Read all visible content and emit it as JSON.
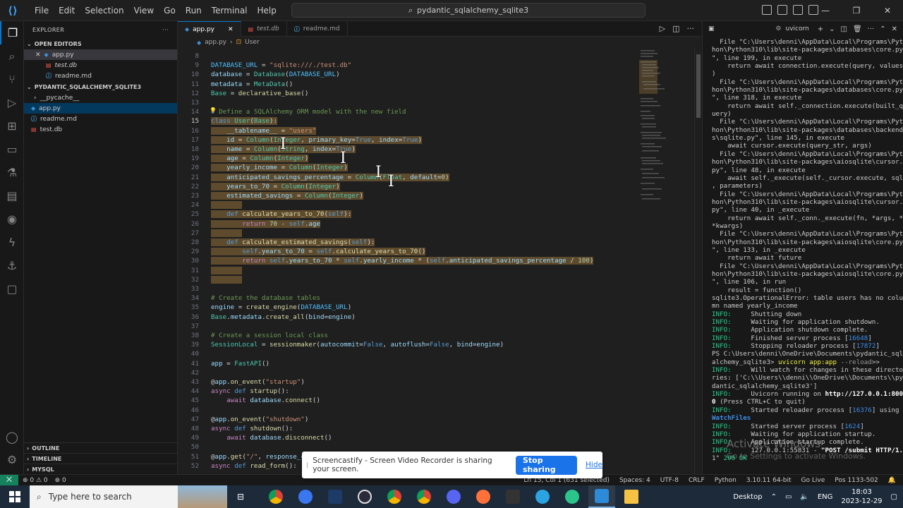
{
  "window": {
    "search": "pydantic_sqlalchemy_sqlite3",
    "menu": [
      "File",
      "Edit",
      "Selection",
      "View",
      "Go",
      "Run",
      "Terminal",
      "Help"
    ]
  },
  "sidebar": {
    "title": "EXPLORER",
    "open_editors_label": "OPEN EDITORS",
    "open_editors": [
      {
        "name": "app.py",
        "icon": "python-icon"
      },
      {
        "name": "test.db",
        "icon": "db-icon"
      },
      {
        "name": "readme.md",
        "icon": "info-icon"
      }
    ],
    "project_label": "PYDANTIC_SQLALCHEMY_SQLITE3",
    "project_items": [
      {
        "name": "__pycache__",
        "icon": "folder-chevron"
      },
      {
        "name": "app.py",
        "icon": "python-icon"
      },
      {
        "name": "readme.md",
        "icon": "info-icon"
      },
      {
        "name": "test.db",
        "icon": "db-icon"
      }
    ],
    "bottom": [
      "OUTLINE",
      "TIMELINE",
      "MYSQL"
    ]
  },
  "tabs": [
    {
      "label": "app.py",
      "active": true
    },
    {
      "label": "test.db",
      "active": false
    },
    {
      "label": "readme.md",
      "active": false
    }
  ],
  "breadcrumb": {
    "file": "app.py",
    "symbol": "User"
  },
  "code_lines": [
    {
      "n": "8",
      "t": ""
    },
    {
      "n": "9",
      "t": "DATABASE_URL = \"sqlite:///./test.db\""
    },
    {
      "n": "10",
      "t": "database = Database(DATABASE_URL)"
    },
    {
      "n": "11",
      "t": "metadata = MetaData()"
    },
    {
      "n": "12",
      "t": "Base = declarative_base()"
    },
    {
      "n": "13",
      "t": ""
    },
    {
      "n": "14",
      "t": "# Define a SQLAlchemy ORM model with the new field"
    },
    {
      "n": "15",
      "t": "class User(Base):"
    },
    {
      "n": "16",
      "t": "    __tablename__ = \"users\""
    },
    {
      "n": "17",
      "t": "    id = Column(Integer, primary_key=True, index=True)"
    },
    {
      "n": "18",
      "t": "    name = Column(String, index=True)"
    },
    {
      "n": "19",
      "t": "    age = Column(Integer)"
    },
    {
      "n": "20",
      "t": "    yearly_income = Column(Integer)"
    },
    {
      "n": "21",
      "t": "    anticipated_savings_percentage = Column(Float, default=0)"
    },
    {
      "n": "22",
      "t": "    years_to_70 = Column(Integer)"
    },
    {
      "n": "23",
      "t": "    estimated_savings = Column(Integer)"
    },
    {
      "n": "24",
      "t": ""
    },
    {
      "n": "25",
      "t": "    def calculate_years_to_70(self):"
    },
    {
      "n": "26",
      "t": "        return 70 - self.age"
    },
    {
      "n": "27",
      "t": ""
    },
    {
      "n": "28",
      "t": "    def calculate_estimated_savings(self):"
    },
    {
      "n": "29",
      "t": "        self.years_to_70 = self.calculate_years_to_70()"
    },
    {
      "n": "30",
      "t": "        return self.years_to_70 * self.yearly_income * (self.anticipated_savings_percentage / 100)"
    },
    {
      "n": "31",
      "t": ""
    },
    {
      "n": "32",
      "t": ""
    },
    {
      "n": "33",
      "t": ""
    },
    {
      "n": "34",
      "t": "# Create the database tables"
    },
    {
      "n": "35",
      "t": "engine = create_engine(DATABASE_URL)"
    },
    {
      "n": "36",
      "t": "Base.metadata.create_all(bind=engine)"
    },
    {
      "n": "37",
      "t": ""
    },
    {
      "n": "38",
      "t": "# Create a session local class"
    },
    {
      "n": "39",
      "t": "SessionLocal = sessionmaker(autocommit=False, autoflush=False, bind=engine)"
    },
    {
      "n": "40",
      "t": ""
    },
    {
      "n": "41",
      "t": "app = FastAPI()"
    },
    {
      "n": "42",
      "t": ""
    },
    {
      "n": "43",
      "t": "@app.on_event(\"startup\")"
    },
    {
      "n": "44",
      "t": "async def startup():"
    },
    {
      "n": "45",
      "t": "    await database.connect()"
    },
    {
      "n": "46",
      "t": ""
    },
    {
      "n": "47",
      "t": "@app.on_event(\"shutdown\")"
    },
    {
      "n": "48",
      "t": "async def shutdown():"
    },
    {
      "n": "49",
      "t": "    await database.disconnect()"
    },
    {
      "n": "50",
      "t": ""
    },
    {
      "n": "51",
      "t": "@app.get(\"/\", response_c"
    },
    {
      "n": "52",
      "t": "async def read_form():"
    }
  ],
  "panel": {
    "label": "uvicorn"
  },
  "terminal": [
    "  File \"C:\\Users\\denni\\AppData\\Local\\Programs\\Pyt",
    "hon\\Python310\\lib\\site-packages\\databases\\core.py",
    "\", line 199, in execute",
    "    return await connection.execute(query, values",
    ")",
    "  File \"C:\\Users\\denni\\AppData\\Local\\Programs\\Pyt",
    "hon\\Python310\\lib\\site-packages\\databases\\core.py",
    "\", line 318, in execute",
    "    return await self._connection.execute(built_q",
    "uery)",
    "  File \"C:\\Users\\denni\\AppData\\Local\\Programs\\Pyt",
    "hon\\Python310\\lib\\site-packages\\databases\\backend",
    "s\\sqlite.py\", line 145, in execute",
    "    await cursor.execute(query_str, args)",
    "  File \"C:\\Users\\denni\\AppData\\Local\\Programs\\Pyt",
    "hon\\Python310\\lib\\site-packages\\aiosqlite\\cursor.",
    "py\", line 48, in execute",
    "    await self._execute(self._cursor.execute, sql",
    ", parameters)",
    "  File \"C:\\Users\\denni\\AppData\\Local\\Programs\\Pyt",
    "hon\\Python310\\lib\\site-packages\\aiosqlite\\cursor.",
    "py\", line 40, in _execute",
    "    return await self._conn._execute(fn, *args, *",
    "*kwargs)",
    "  File \"C:\\Users\\denni\\AppData\\Local\\Programs\\Pyt",
    "hon\\Python310\\lib\\site-packages\\aiosqlite\\core.py",
    "\", line 133, in _execute",
    "    return await future",
    "  File \"C:\\Users\\denni\\AppData\\Local\\Programs\\Pyt",
    "hon\\Python310\\lib\\site-packages\\aiosqlite\\core.py",
    "\", line 106, in run",
    "    result = function()",
    "sqlite3.OperationalError: table users has no colu",
    "mn named yearly_income",
    "INFO:     Shutting down",
    "INFO:     Waiting for application shutdown.",
    "INFO:     Application shutdown complete.",
    "INFO:     Finished server process [16648]",
    "INFO:     Stopping reloader process [17872]",
    "PS C:\\Users\\denni\\OneDrive\\Documents\\pydantic_sql",
    "alchemy_sqlite3> uvicorn app:app --reload>>",
    "INFO:     Will watch for changes in these directo",
    "ries: ['C:\\\\Users\\\\denni\\\\OneDrive\\\\Documents\\\\py",
    "dantic_sqlalchemy_sqlite3']",
    "INFO:     Uvicorn running on http://127.0.0.1:800",
    "0 (Press CTRL+C to quit)",
    "INFO:     Started reloader process [16376] using",
    "WatchFiles",
    "INFO:     Started server process [1624]",
    "INFO:     Waiting for application startup.",
    "INFO:     Application startup complete.",
    "INFO:     127.0.0.1:55831 - \"POST /submit HTTP/1.",
    "1\" 200 OK"
  ],
  "statusbar": {
    "left": "⊗ 0 ⚠ 0",
    "ports": "⊗ 0",
    "cursor": "Ln 15, Col 1 (631 selected)",
    "spaces": "Spaces: 4",
    "encoding": "UTF-8",
    "eol": "CRLF",
    "lang": "Python",
    "interp": "3.10.11 64-bit",
    "golive": "Go Live",
    "pos": "Pos 1133-502"
  },
  "share": {
    "text": "Screencastify - Screen Video Recorder is sharing your screen.",
    "stop": "Stop sharing",
    "hide": "Hide"
  },
  "watermark": {
    "title": "Activate Windows",
    "sub": "Go to Settings to activate Windows."
  },
  "taskbar": {
    "search": "Type here to search",
    "desktop": "Desktop",
    "lang": "ENG",
    "time": "18:03",
    "date": "2023-12-29"
  }
}
